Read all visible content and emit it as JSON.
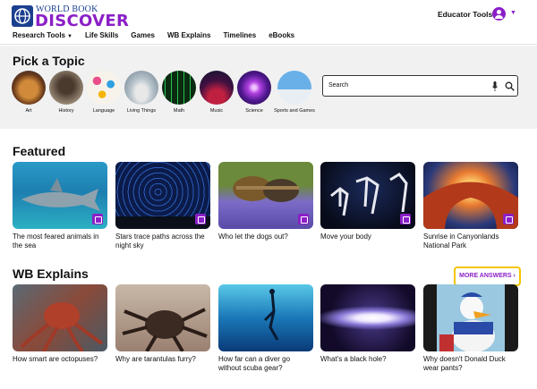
{
  "header": {
    "logo_top": "WORLD BOOK",
    "logo_bottom": "DISCOVER",
    "educator_tools": "Educator Tools",
    "nav": [
      {
        "label": "Research Tools",
        "has_caret": true
      },
      {
        "label": "Life Skills"
      },
      {
        "label": "Games"
      },
      {
        "label": "WB Explains"
      },
      {
        "label": "Timelines"
      },
      {
        "label": "eBooks"
      }
    ]
  },
  "topics": {
    "title": "Pick a Topic",
    "items": [
      {
        "label": "Art"
      },
      {
        "label": "History"
      },
      {
        "label": "Language"
      },
      {
        "label": "Living Things"
      },
      {
        "label": "Math"
      },
      {
        "label": "Music"
      },
      {
        "label": "Science"
      },
      {
        "label": "Sports and Games"
      }
    ],
    "search_placeholder": "Search"
  },
  "featured": {
    "title": "Featured",
    "cards": [
      {
        "title": "The most feared animals in the sea",
        "badge": "book-icon"
      },
      {
        "title": "Stars trace paths across the night sky",
        "badge": "image-icon"
      },
      {
        "title": "Who let the dogs out?",
        "badge": "book-icon"
      },
      {
        "title": "Move your body",
        "badge": "book-icon"
      },
      {
        "title": "Sunrise in Canyonlands National Park",
        "badge": "vr-icon"
      }
    ]
  },
  "wb_explains": {
    "title": "WB Explains",
    "more_label": "MORE ANSWERS ›",
    "cards": [
      {
        "title": "How smart are octopuses?"
      },
      {
        "title": "Why are tarantulas furry?"
      },
      {
        "title": "How far can a diver go without scuba gear?"
      },
      {
        "title": "What's a black hole?"
      },
      {
        "title": "Why doesn't Donald Duck wear pants?"
      }
    ]
  },
  "colors": {
    "brand_purple": "#8b1fc7",
    "highlight_yellow": "#f5c400"
  }
}
